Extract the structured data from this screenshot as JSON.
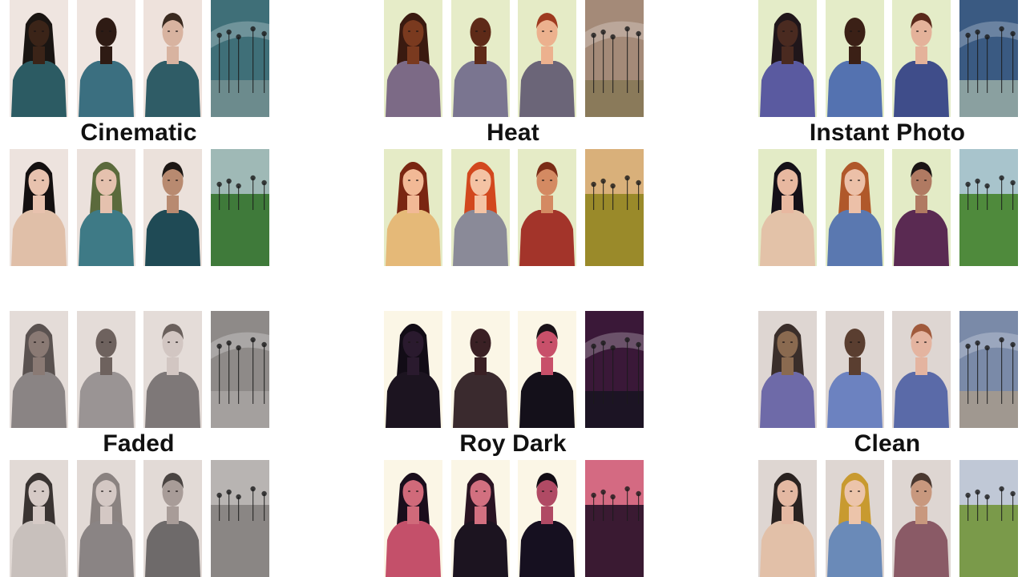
{
  "filters": [
    {
      "label": "Cinematic",
      "top": [
        {
          "subject": "woman-dark-hair-bun",
          "bg": "#efe5e0",
          "skin": "#3b2418",
          "hair": "#1a1512",
          "shirt": "#2c5b63"
        },
        {
          "subject": "man-bald",
          "bg": "#efe5e0",
          "skin": "#2e1b14",
          "hair": "#1b1410",
          "shirt": "#3b6f80"
        },
        {
          "subject": "man-short-hair",
          "bg": "#eee2dc",
          "skin": "#d8b3a0",
          "hair": "#3a2a20",
          "shirt": "#2f5c66"
        },
        {
          "subject": "beach-sky",
          "sky": "#3f6f78",
          "ground": "#6c8b8d"
        }
      ],
      "bottom": [
        {
          "subject": "woman-long-black-hair",
          "bg": "#ede3de",
          "skin": "#e8c2ae",
          "hair": "#141010",
          "shirt": "#e0bfa8"
        },
        {
          "subject": "woman-wavy-hair",
          "bg": "#ebe1dc",
          "skin": "#e5c1ae",
          "hair": "#5b6a3c",
          "shirt": "#3e7a86"
        },
        {
          "subject": "man-dark-hair",
          "bg": "#ebe1db",
          "skin": "#b88a70",
          "hair": "#1c1714",
          "shirt": "#1f4a55"
        },
        {
          "subject": "park-grass",
          "sky": "#9fb9b6",
          "ground": "#3f7a3a"
        }
      ]
    },
    {
      "label": "Heat",
      "top": [
        {
          "subject": "woman-dark-hair-bun",
          "bg": "#e6ecc8",
          "skin": "#7a3a1f",
          "hair": "#3a1a10",
          "shirt": "#7c6a86"
        },
        {
          "subject": "man-bald",
          "bg": "#e6ecc8",
          "skin": "#5e2a18",
          "hair": "#3b1a10",
          "shirt": "#7a7590"
        },
        {
          "subject": "man-short-hair",
          "bg": "#e5ebc6",
          "skin": "#ecb18e",
          "hair": "#9e3a1f",
          "shirt": "#6b6578"
        },
        {
          "subject": "beach-sky",
          "sky": "#a48a78",
          "ground": "#8a7a5a"
        }
      ],
      "bottom": [
        {
          "subject": "woman-long-black-hair",
          "bg": "#e5ebc6",
          "skin": "#f2b996",
          "hair": "#7a2612",
          "shirt": "#e5b978"
        },
        {
          "subject": "woman-wavy-hair",
          "bg": "#e5ebc6",
          "skin": "#f4c3a4",
          "hair": "#d2481e",
          "shirt": "#8a8a98"
        },
        {
          "subject": "man-dark-hair",
          "bg": "#e5ebc6",
          "skin": "#d48a62",
          "hair": "#7a2c16",
          "shirt": "#a3342a"
        },
        {
          "subject": "park-grass",
          "sky": "#d9b07a",
          "ground": "#9a8a2a"
        }
      ]
    },
    {
      "label": "Instant Photo",
      "top": [
        {
          "subject": "woman-dark-hair-bun",
          "bg": "#e4ecc8",
          "skin": "#4a2a20",
          "hair": "#20161a",
          "shirt": "#5a5aa0"
        },
        {
          "subject": "man-bald",
          "bg": "#e4ecc8",
          "skin": "#3b2016",
          "hair": "#1d1410",
          "shirt": "#5472b0"
        },
        {
          "subject": "man-short-hair",
          "bg": "#e4ecc8",
          "skin": "#e4b29a",
          "hair": "#5a2a1c",
          "shirt": "#3f4d8a"
        },
        {
          "subject": "beach-sky",
          "sky": "#3a5a82",
          "ground": "#8aa0a0"
        }
      ],
      "bottom": [
        {
          "subject": "woman-long-black-hair",
          "bg": "#e3ebc6",
          "skin": "#e8b8a0",
          "hair": "#141018",
          "shirt": "#e3c2a8"
        },
        {
          "subject": "woman-wavy-hair",
          "bg": "#e3ebc6",
          "skin": "#ecc0a8",
          "hair": "#b0582a",
          "shirt": "#5a78b0"
        },
        {
          "subject": "man-dark-hair",
          "bg": "#e3ebc6",
          "skin": "#b07a62",
          "hair": "#1a1414",
          "shirt": "#5a2a52"
        },
        {
          "subject": "park-grass",
          "sky": "#a8c4cc",
          "ground": "#4f8a3c"
        }
      ]
    },
    {
      "label": "Faded",
      "top": [
        {
          "subject": "woman-dark-hair-bun",
          "bg": "#e4dcd8",
          "skin": "#8a7a74",
          "hair": "#5a5250",
          "shirt": "#8a8484"
        },
        {
          "subject": "man-bald",
          "bg": "#e4dcd8",
          "skin": "#6e625e",
          "hair": "#4a4442",
          "shirt": "#9a9494"
        },
        {
          "subject": "man-short-hair",
          "bg": "#e4dcd8",
          "skin": "#d2c6c2",
          "hair": "#6a605c",
          "shirt": "#7e7878"
        },
        {
          "subject": "beach-sky",
          "sky": "#8e8a88",
          "ground": "#a4a09e"
        }
      ],
      "bottom": [
        {
          "subject": "woman-long-black-hair",
          "bg": "#e2dad6",
          "skin": "#d6cac6",
          "hair": "#3a3432",
          "shirt": "#c8c0bc"
        },
        {
          "subject": "woman-wavy-hair",
          "bg": "#e2dad6",
          "skin": "#d4c8c4",
          "hair": "#8a8280",
          "shirt": "#8a8484"
        },
        {
          "subject": "man-dark-hair",
          "bg": "#e2dad6",
          "skin": "#a89c98",
          "hair": "#4a4442",
          "shirt": "#6e6a6a"
        },
        {
          "subject": "park-grass",
          "sky": "#b8b4b2",
          "ground": "#8a8684"
        }
      ]
    },
    {
      "label": "Roy Dark",
      "top": [
        {
          "subject": "woman-dark-hair-bun",
          "bg": "#fbf6e6",
          "skin": "#2a1a2e",
          "hair": "#120c16",
          "shirt": "#1c1420"
        },
        {
          "subject": "man-bald",
          "bg": "#fbf6e6",
          "skin": "#3a2024",
          "hair": "#160e14",
          "shirt": "#3a2a2e"
        },
        {
          "subject": "man-short-hair",
          "bg": "#fbf6e6",
          "skin": "#c8506a",
          "hair": "#1a1218",
          "shirt": "#14101a"
        },
        {
          "subject": "beach-sky",
          "sky": "#3a1838",
          "ground": "#1c1424"
        }
      ],
      "bottom": [
        {
          "subject": "woman-long-black-hair",
          "bg": "#fbf6e6",
          "skin": "#d06a7a",
          "hair": "#1a0e1c",
          "shirt": "#c4506a"
        },
        {
          "subject": "woman-wavy-hair",
          "bg": "#fbf6e6",
          "skin": "#d27080",
          "hair": "#2a1422",
          "shirt": "#1c1420"
        },
        {
          "subject": "man-dark-hair",
          "bg": "#fbf6e6",
          "skin": "#b04a64",
          "hair": "#120c14",
          "shirt": "#161020"
        },
        {
          "subject": "park-grass",
          "sky": "#d46a82",
          "ground": "#3a1a32"
        }
      ]
    },
    {
      "label": "Clean",
      "top": [
        {
          "subject": "woman-dark-hair-bun",
          "bg": "#ded6d2",
          "skin": "#8a6a50",
          "hair": "#3a2e2a",
          "shirt": "#6e6aa8"
        },
        {
          "subject": "man-bald",
          "bg": "#ded6d2",
          "skin": "#5a3e30",
          "hair": "#2a201c",
          "shirt": "#6c82c0"
        },
        {
          "subject": "man-short-hair",
          "bg": "#ded6d2",
          "skin": "#e4b4a0",
          "hair": "#a05a3c",
          "shirt": "#5a6aa8"
        },
        {
          "subject": "beach-sky",
          "sky": "#7a8aa8",
          "ground": "#a09890"
        }
      ],
      "bottom": [
        {
          "subject": "woman-long-black-hair",
          "bg": "#ded6d2",
          "skin": "#e4b8a2",
          "hair": "#2a2220",
          "shirt": "#e2c0a8"
        },
        {
          "subject": "woman-wavy-hair",
          "bg": "#ded6d2",
          "skin": "#ecc4aa",
          "hair": "#c89a30",
          "shirt": "#6a8ab8"
        },
        {
          "subject": "man-dark-hair",
          "bg": "#ded6d2",
          "skin": "#c8987e",
          "hair": "#4a3830",
          "shirt": "#8a5a66"
        },
        {
          "subject": "park-grass",
          "sky": "#c0c8d6",
          "ground": "#7a9a4a"
        }
      ]
    }
  ]
}
